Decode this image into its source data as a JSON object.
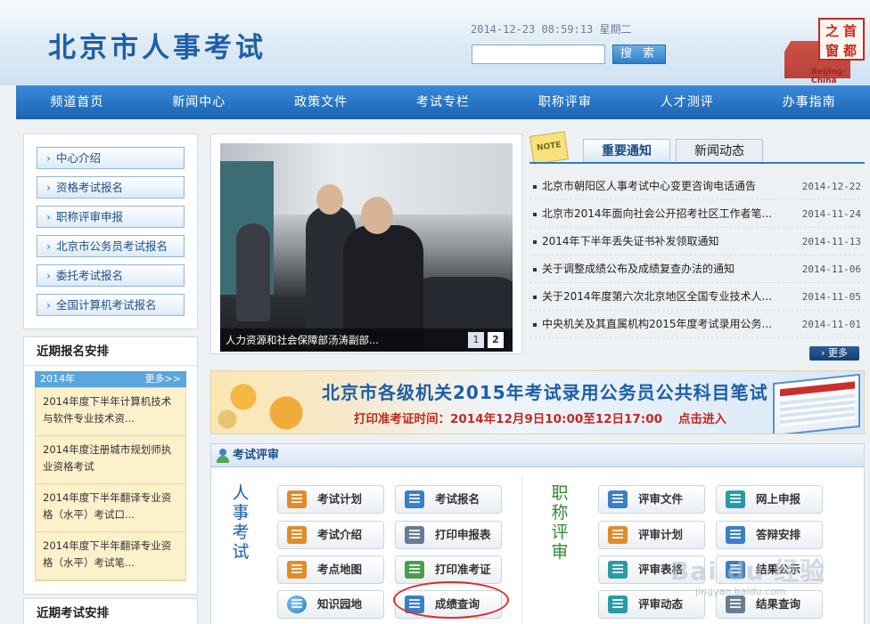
{
  "header": {
    "site_title": "北京市人事考试",
    "datetime": "2014-12-23 08:59:13 星期二",
    "search_button": "搜 索",
    "logo": {
      "line1": "首",
      "line2": "都",
      "line3": "之",
      "line4": "窗",
      "caption": "Beijing-China"
    }
  },
  "nav": [
    {
      "label": "频道首页"
    },
    {
      "label": "新闻中心"
    },
    {
      "label": "政策文件"
    },
    {
      "label": "考试专栏"
    },
    {
      "label": "职称评审"
    },
    {
      "label": "人才测评"
    },
    {
      "label": "办事指南"
    }
  ],
  "sidebar": {
    "links": [
      {
        "label": "中心介绍"
      },
      {
        "label": "资格考试报名"
      },
      {
        "label": "职称评审申报"
      },
      {
        "label": "北京市公务员考试报名"
      },
      {
        "label": "委托考试报名"
      },
      {
        "label": "全国计算机考试报名"
      }
    ],
    "schedule": {
      "title": "近期报名安排",
      "tab_label": "2014年",
      "more": "更多>>",
      "items": [
        {
          "text": "2014年度下半年计算机技术与软件专业技术资..."
        },
        {
          "text": "2014年度注册城市规划师执业资格考试"
        },
        {
          "text": "2014年度下半年翻译专业资格（水平）考试口..."
        },
        {
          "text": "2014年度下半年翻译专业资格（水平）考试笔..."
        }
      ]
    },
    "exam_title": "近期考试安排"
  },
  "slideshow": {
    "caption": "人力资源和社会保障部汤涛副部...",
    "pages": [
      "1",
      "2"
    ]
  },
  "notices": {
    "note_icon": "NOTE",
    "tabs": [
      "重要通知",
      "新闻动态"
    ],
    "items": [
      {
        "title": "北京市朝阳区人事考试中心变更咨询电话通告",
        "date": "2014-12-22"
      },
      {
        "title": "北京市2014年面向社会公开招考社区工作者笔...",
        "date": "2014-11-24"
      },
      {
        "title": "2014年下半年丢失证书补发领取通知",
        "date": "2014-11-13"
      },
      {
        "title": "关于调整成绩公布及成绩复查办法的通知",
        "date": "2014-11-06"
      },
      {
        "title": "关于2014年度第六次北京地区全国专业技术人...",
        "date": "2014-11-05"
      },
      {
        "title": "中央机关及其直属机构2015年度考试录用公务...",
        "date": "2014-11-01"
      }
    ],
    "more": "› 更多"
  },
  "banner": {
    "title": "北京市各级机关2015年考试录用公务员公共科目笔试",
    "subtitle": "打印准考证时间：2014年12月9日10:00至12日17:00",
    "cta": "点击进入"
  },
  "review": {
    "title": "考试评审",
    "left_label": [
      "人",
      "事",
      "考",
      "试"
    ],
    "right_label": [
      "职",
      "称",
      "评",
      "审"
    ],
    "buttons_left": [
      {
        "label": "考试计划",
        "icon": "calendar-icon"
      },
      {
        "label": "考试报名",
        "icon": "pen-form-icon"
      },
      {
        "label": "考试介绍",
        "icon": "document-list-icon"
      },
      {
        "label": "打印申报表",
        "icon": "printer-icon"
      },
      {
        "label": "考点地图",
        "icon": "map-icon"
      },
      {
        "label": "打印准考证",
        "icon": "printer-green-icon"
      },
      {
        "label": "知识园地",
        "icon": "globe-icon"
      },
      {
        "label": "成绩查询",
        "icon": "score-search-icon"
      }
    ],
    "buttons_right": [
      {
        "label": "评审文件",
        "icon": "file-icon"
      },
      {
        "label": "网上申报",
        "icon": "computer-icon"
      },
      {
        "label": "评审计划",
        "icon": "clipboard-icon"
      },
      {
        "label": "答辩安排",
        "icon": "magnifier-doc-icon"
      },
      {
        "label": "评审表格",
        "icon": "table-icon"
      },
      {
        "label": "结果公示",
        "icon": "bulletin-icon"
      },
      {
        "label": "评审动态",
        "icon": "clock-icon"
      },
      {
        "label": "结果查询",
        "icon": "search-icon"
      }
    ]
  },
  "watermark": {
    "main": "Bai du 经验",
    "sub": "jingyan.baidu.com"
  }
}
